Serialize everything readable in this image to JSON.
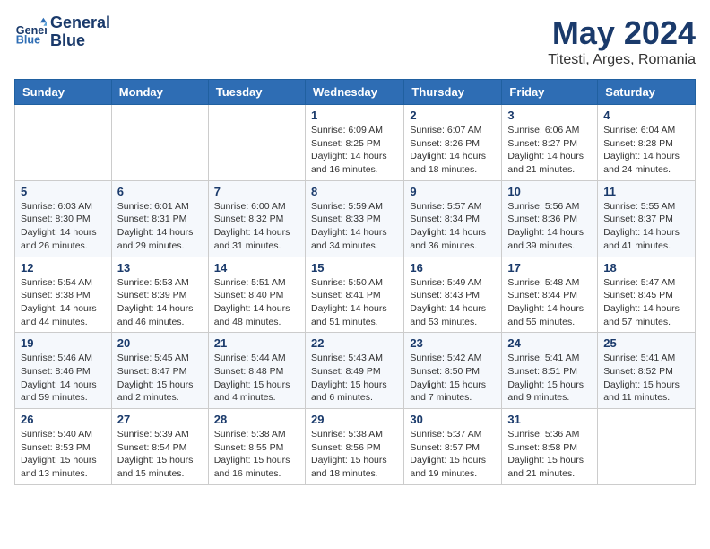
{
  "logo": {
    "name": "GeneralBlue",
    "line1": "General",
    "line2": "Blue"
  },
  "title": "May 2024",
  "subtitle": "Titesti, Arges, Romania",
  "days_of_week": [
    "Sunday",
    "Monday",
    "Tuesday",
    "Wednesday",
    "Thursday",
    "Friday",
    "Saturday"
  ],
  "weeks": [
    [
      {
        "day": "",
        "detail": ""
      },
      {
        "day": "",
        "detail": ""
      },
      {
        "day": "",
        "detail": ""
      },
      {
        "day": "1",
        "detail": "Sunrise: 6:09 AM\nSunset: 8:25 PM\nDaylight: 14 hours\nand 16 minutes."
      },
      {
        "day": "2",
        "detail": "Sunrise: 6:07 AM\nSunset: 8:26 PM\nDaylight: 14 hours\nand 18 minutes."
      },
      {
        "day": "3",
        "detail": "Sunrise: 6:06 AM\nSunset: 8:27 PM\nDaylight: 14 hours\nand 21 minutes."
      },
      {
        "day": "4",
        "detail": "Sunrise: 6:04 AM\nSunset: 8:28 PM\nDaylight: 14 hours\nand 24 minutes."
      }
    ],
    [
      {
        "day": "5",
        "detail": "Sunrise: 6:03 AM\nSunset: 8:30 PM\nDaylight: 14 hours\nand 26 minutes."
      },
      {
        "day": "6",
        "detail": "Sunrise: 6:01 AM\nSunset: 8:31 PM\nDaylight: 14 hours\nand 29 minutes."
      },
      {
        "day": "7",
        "detail": "Sunrise: 6:00 AM\nSunset: 8:32 PM\nDaylight: 14 hours\nand 31 minutes."
      },
      {
        "day": "8",
        "detail": "Sunrise: 5:59 AM\nSunset: 8:33 PM\nDaylight: 14 hours\nand 34 minutes."
      },
      {
        "day": "9",
        "detail": "Sunrise: 5:57 AM\nSunset: 8:34 PM\nDaylight: 14 hours\nand 36 minutes."
      },
      {
        "day": "10",
        "detail": "Sunrise: 5:56 AM\nSunset: 8:36 PM\nDaylight: 14 hours\nand 39 minutes."
      },
      {
        "day": "11",
        "detail": "Sunrise: 5:55 AM\nSunset: 8:37 PM\nDaylight: 14 hours\nand 41 minutes."
      }
    ],
    [
      {
        "day": "12",
        "detail": "Sunrise: 5:54 AM\nSunset: 8:38 PM\nDaylight: 14 hours\nand 44 minutes."
      },
      {
        "day": "13",
        "detail": "Sunrise: 5:53 AM\nSunset: 8:39 PM\nDaylight: 14 hours\nand 46 minutes."
      },
      {
        "day": "14",
        "detail": "Sunrise: 5:51 AM\nSunset: 8:40 PM\nDaylight: 14 hours\nand 48 minutes."
      },
      {
        "day": "15",
        "detail": "Sunrise: 5:50 AM\nSunset: 8:41 PM\nDaylight: 14 hours\nand 51 minutes."
      },
      {
        "day": "16",
        "detail": "Sunrise: 5:49 AM\nSunset: 8:43 PM\nDaylight: 14 hours\nand 53 minutes."
      },
      {
        "day": "17",
        "detail": "Sunrise: 5:48 AM\nSunset: 8:44 PM\nDaylight: 14 hours\nand 55 minutes."
      },
      {
        "day": "18",
        "detail": "Sunrise: 5:47 AM\nSunset: 8:45 PM\nDaylight: 14 hours\nand 57 minutes."
      }
    ],
    [
      {
        "day": "19",
        "detail": "Sunrise: 5:46 AM\nSunset: 8:46 PM\nDaylight: 14 hours\nand 59 minutes."
      },
      {
        "day": "20",
        "detail": "Sunrise: 5:45 AM\nSunset: 8:47 PM\nDaylight: 15 hours\nand 2 minutes."
      },
      {
        "day": "21",
        "detail": "Sunrise: 5:44 AM\nSunset: 8:48 PM\nDaylight: 15 hours\nand 4 minutes."
      },
      {
        "day": "22",
        "detail": "Sunrise: 5:43 AM\nSunset: 8:49 PM\nDaylight: 15 hours\nand 6 minutes."
      },
      {
        "day": "23",
        "detail": "Sunrise: 5:42 AM\nSunset: 8:50 PM\nDaylight: 15 hours\nand 7 minutes."
      },
      {
        "day": "24",
        "detail": "Sunrise: 5:41 AM\nSunset: 8:51 PM\nDaylight: 15 hours\nand 9 minutes."
      },
      {
        "day": "25",
        "detail": "Sunrise: 5:41 AM\nSunset: 8:52 PM\nDaylight: 15 hours\nand 11 minutes."
      }
    ],
    [
      {
        "day": "26",
        "detail": "Sunrise: 5:40 AM\nSunset: 8:53 PM\nDaylight: 15 hours\nand 13 minutes."
      },
      {
        "day": "27",
        "detail": "Sunrise: 5:39 AM\nSunset: 8:54 PM\nDaylight: 15 hours\nand 15 minutes."
      },
      {
        "day": "28",
        "detail": "Sunrise: 5:38 AM\nSunset: 8:55 PM\nDaylight: 15 hours\nand 16 minutes."
      },
      {
        "day": "29",
        "detail": "Sunrise: 5:38 AM\nSunset: 8:56 PM\nDaylight: 15 hours\nand 18 minutes."
      },
      {
        "day": "30",
        "detail": "Sunrise: 5:37 AM\nSunset: 8:57 PM\nDaylight: 15 hours\nand 19 minutes."
      },
      {
        "day": "31",
        "detail": "Sunrise: 5:36 AM\nSunset: 8:58 PM\nDaylight: 15 hours\nand 21 minutes."
      },
      {
        "day": "",
        "detail": ""
      }
    ]
  ]
}
